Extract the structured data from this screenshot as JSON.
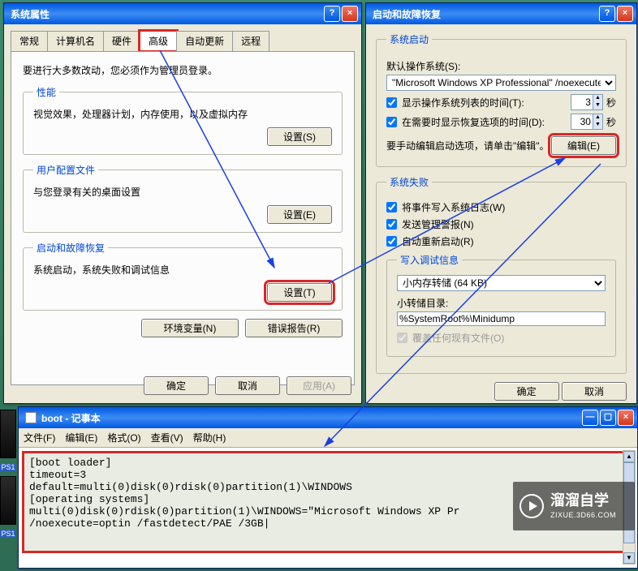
{
  "sys_props": {
    "title": "系统属性",
    "tabs": [
      "常规",
      "计算机名",
      "硬件",
      "高级",
      "自动更新",
      "远程"
    ],
    "active_tab": "高级",
    "note": "要进行大多数改动，您必须作为管理员登录。",
    "perf": {
      "legend": "性能",
      "desc": "视觉效果，处理器计划，内存使用，以及虚拟内存",
      "btn": "设置(S)"
    },
    "profiles": {
      "legend": "用户配置文件",
      "desc": "与您登录有关的桌面设置",
      "btn": "设置(E)"
    },
    "startup_group": {
      "legend": "启动和故障恢复",
      "desc": "系统启动，系统失败和调试信息",
      "btn": "设置(T)"
    },
    "env_btn": "环境变量(N)",
    "err_btn": "错误报告(R)",
    "ok": "确定",
    "cancel": "取消",
    "apply": "应用(A)"
  },
  "startup": {
    "title": "启动和故障恢复",
    "sys_start_legend": "系统启动",
    "default_os_label": "默认操作系统(S):",
    "default_os_value": "\"Microsoft Windows XP Professional\" /noexecute=optin",
    "show_os_list": "显示操作系统列表的时间(T):",
    "show_os_list_val": "3",
    "show_recovery": "在需要时显示恢复选项的时间(D):",
    "show_recovery_val": "30",
    "seconds": "秒",
    "manual_edit": "要手动编辑启动选项，请单击\"编辑\"。",
    "edit_btn": "编辑(E)",
    "sys_fail_legend": "系统失败",
    "write_event": "将事件写入系统日志(W)",
    "send_alert": "发送管理警报(N)",
    "auto_restart": "自动重新启动(R)",
    "debug_legend": "写入调试信息",
    "dump_type": "小内存转储 (64 KB)",
    "dump_dir_label": "小转储目录:",
    "dump_dir": "%SystemRoot%\\Minidump",
    "overwrite": "覆盖任何现有文件(O)",
    "ok": "确定",
    "cancel": "取消"
  },
  "notepad": {
    "title": "boot - 记事本",
    "menus": {
      "file": "文件(F)",
      "edit": "编辑(E)",
      "format": "格式(O)",
      "view": "查看(V)",
      "help": "帮助(H)"
    },
    "content": "[boot loader]\ntimeout=3\ndefault=multi(0)disk(0)rdisk(0)partition(1)\\WINDOWS\n[operating systems]\nmulti(0)disk(0)rdisk(0)partition(1)\\WINDOWS=\"Microsoft Windows XP Pr\n/noexecute=optin /fastdetect/PAE /3GB|"
  },
  "watermark": {
    "main": "溜溜自学",
    "sub": "ZIXUE.3D66.COM"
  },
  "desk_label": "PS1"
}
